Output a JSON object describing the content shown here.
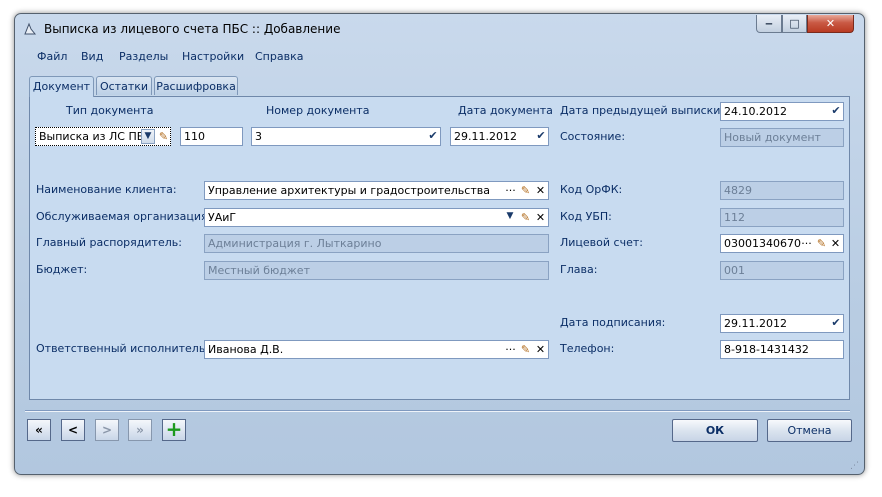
{
  "window": {
    "title": "Выписка из лицевого счета ПБС :: Добавление",
    "min_glyph": "‒",
    "max_glyph": "□",
    "close_glyph": "✕"
  },
  "menu": [
    "Файл",
    "Вид",
    "Разделы",
    "Настройки",
    "Справка"
  ],
  "tabs": [
    "Документ",
    "Остатки",
    "Расшифровка"
  ],
  "form": {
    "doc_type": {
      "label": "Тип документа",
      "value": "Выписка из ЛС ПБС"
    },
    "doc_code": {
      "value": "110"
    },
    "doc_number": {
      "label": "Номер документа",
      "value": "3"
    },
    "doc_date": {
      "label": "Дата документа",
      "value": "29.11.2012"
    },
    "prev_date": {
      "label": "Дата предыдущей выписки:",
      "value": "24.10.2012"
    },
    "state": {
      "label": "Состояние:",
      "value": "Новый документ"
    },
    "client": {
      "label": "Наименование клиента:",
      "value": "Управление архитектуры и градостроительства"
    },
    "org": {
      "label": "Обслуживаемая организация:",
      "value": "УАиГ"
    },
    "manager": {
      "label": "Главный распорядитель:",
      "value": "Администрация г. Лыткарино"
    },
    "budget": {
      "label": "Бюджет:",
      "value": "Местный бюджет"
    },
    "ofk": {
      "label": "Код ОрФК:",
      "value": "4829"
    },
    "ubp": {
      "label": "Код УБП:",
      "value": "112"
    },
    "account": {
      "label": "Лицевой счет:",
      "value": "03001340670"
    },
    "chapter": {
      "label": "Глава:",
      "value": "001"
    },
    "sign_date": {
      "label": "Дата подписания:",
      "value": "29.11.2012"
    },
    "executor": {
      "label": "Ответственный исполнитель:",
      "value": "Иванова Д.В."
    },
    "phone": {
      "label": "Телефон:",
      "value": "8-918-1431432"
    }
  },
  "glyphs": {
    "dropdown": "▼",
    "checkdown": "✔",
    "ellipsis": "···",
    "pencil": "✎",
    "clear": "✕"
  },
  "nav": {
    "first": "«",
    "prev": "<",
    "next": ">",
    "last": "»",
    "add": "+"
  },
  "buttons": {
    "ok": "ОК",
    "cancel": "Отмена"
  },
  "colors": {
    "window_bg": "#c9d9ec",
    "panel_bg": "#c8dbf0",
    "text": "#0b2e66",
    "close": "#c95a45",
    "add": "#1e9a1e"
  }
}
